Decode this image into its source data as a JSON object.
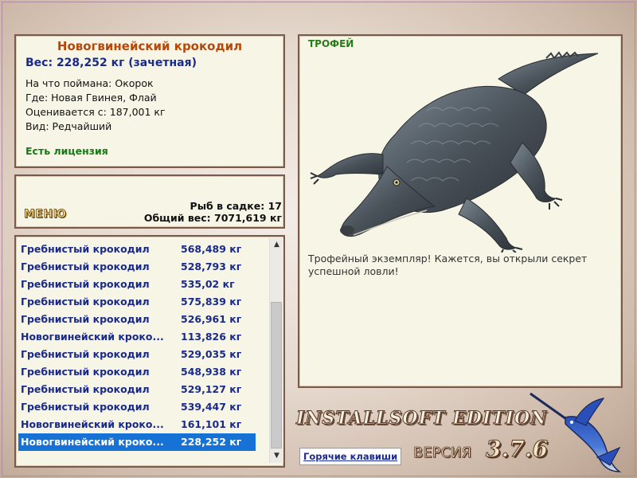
{
  "info": {
    "title": "Новогвинейский крокодил",
    "weight": "Вес: 228,252 кг (зачетная)",
    "facts": [
      "На что поймана: Окорок",
      "Где: Новая Гвинея, Флай",
      "Оценивается с: 187,001 кг",
      "Вид: Редчайший"
    ],
    "license": "Есть лицензия"
  },
  "stats": {
    "menu_label": "МЕНЮ",
    "fish_in_cage": "Рыб в садке: 17",
    "total_weight": "Общий вес: 7071,619 кг"
  },
  "catch_list": [
    {
      "name": "Гребнистый крокодил",
      "weight": "568,489 кг"
    },
    {
      "name": "Гребнистый крокодил",
      "weight": "528,793 кг"
    },
    {
      "name": "Гребнистый крокодил",
      "weight": "535,02 кг"
    },
    {
      "name": "Гребнистый крокодил",
      "weight": "575,839 кг"
    },
    {
      "name": "Гребнистый крокодил",
      "weight": "526,961 кг"
    },
    {
      "name": "Новогвинейский кроко...",
      "weight": "113,826 кг"
    },
    {
      "name": "Гребнистый крокодил",
      "weight": "529,035 кг"
    },
    {
      "name": "Гребнистый крокодил",
      "weight": "548,938 кг"
    },
    {
      "name": "Гребнистый крокодил",
      "weight": "529,127 кг"
    },
    {
      "name": "Гребнистый крокодил",
      "weight": "539,447 кг"
    },
    {
      "name": "Новогвинейский кроко...",
      "weight": "161,101 кг"
    },
    {
      "name": "Новогвинейский кроко...",
      "weight": "228,252 кг",
      "selected": true
    }
  ],
  "trophy": {
    "label": "ТРОФЕЙ",
    "description": "Трофейный экземпляр! Кажется, вы открыли секрет успешной ловли!"
  },
  "footer": {
    "edition": "INSTALLSOFT EDITION",
    "version_label": "ВЕРСИЯ",
    "version_number": "3.7.6",
    "hotkeys_label": "Горячие клавиши"
  },
  "colors": {
    "title": "#b8480a",
    "weight": "#1a2a8a",
    "license": "#177a17",
    "selection": "#1672d4",
    "panel_bg": "#f7f6e6",
    "panel_border": "#7a5a4a"
  },
  "icons": {
    "scroll_up": "chevron-up-icon",
    "scroll_down": "chevron-down-icon"
  }
}
